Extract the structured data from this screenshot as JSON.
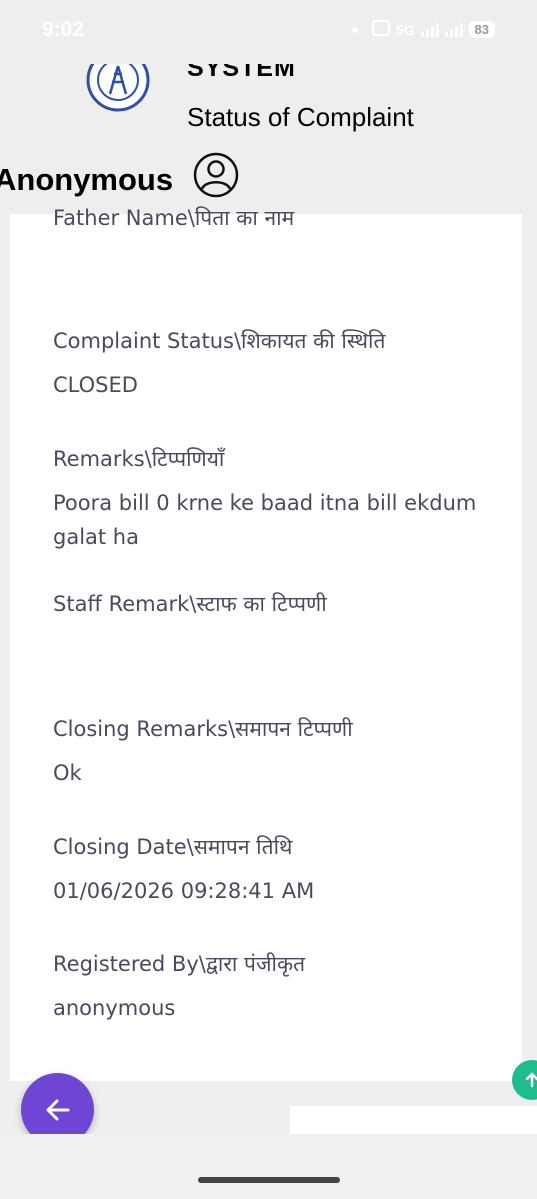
{
  "status_bar": {
    "time": "9:02",
    "network": "5G",
    "battery": "83"
  },
  "header": {
    "system_title": "SYSTEM",
    "page_title": "Status of Complaint",
    "user_name": "Anonymous"
  },
  "fields": [
    {
      "label": "Father Name\\पिता का नाम",
      "value": ""
    },
    {
      "label": "Complaint Status\\शिकायत की स्थिति",
      "value": "CLOSED"
    },
    {
      "label": "Remarks\\टिप्पणियाँ",
      "value": "Poora bill 0 krne ke baad itna bill ekdum galat ha"
    },
    {
      "label": "Staff Remark\\स्टाफ का टिप्पणी",
      "value": ""
    },
    {
      "label": "Closing Remarks\\समापन टिप्पणी",
      "value": "Ok"
    },
    {
      "label": "Closing Date\\समापन तिथि",
      "value": "01/06/2026 09:28:41 AM"
    },
    {
      "label": "Registered By\\द्वारा पंजीकृत",
      "value": "anonymous"
    }
  ],
  "colors": {
    "accent": "#6e45d4",
    "secondary_fab": "#1ebc8f",
    "text": "#4a4a5e"
  }
}
